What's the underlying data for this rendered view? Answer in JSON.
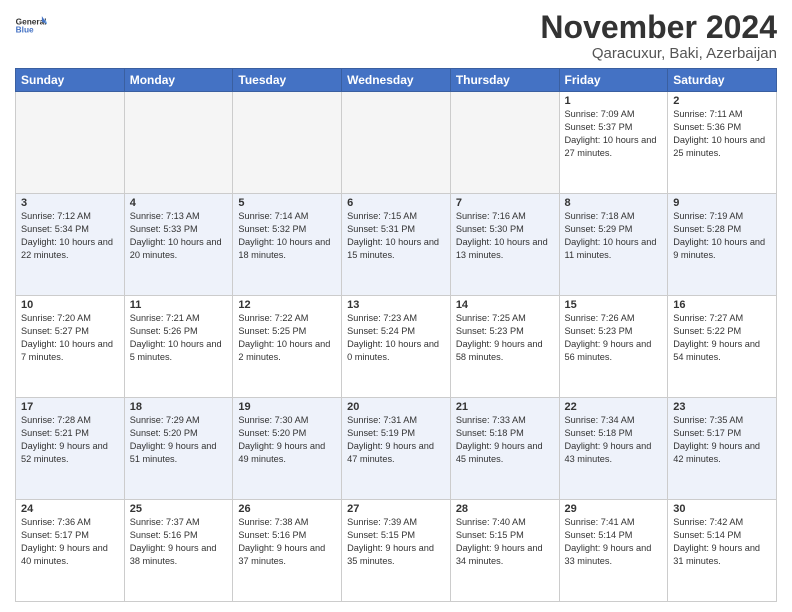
{
  "header": {
    "logo_general": "General",
    "logo_blue": "Blue",
    "month_title": "November 2024",
    "location": "Qaracuxur, Baki, Azerbaijan"
  },
  "days_of_week": [
    "Sunday",
    "Monday",
    "Tuesday",
    "Wednesday",
    "Thursday",
    "Friday",
    "Saturday"
  ],
  "weeks": [
    [
      {
        "day": "",
        "info": "",
        "empty": true
      },
      {
        "day": "",
        "info": "",
        "empty": true
      },
      {
        "day": "",
        "info": "",
        "empty": true
      },
      {
        "day": "",
        "info": "",
        "empty": true
      },
      {
        "day": "",
        "info": "",
        "empty": true
      },
      {
        "day": "1",
        "info": "Sunrise: 7:09 AM\nSunset: 5:37 PM\nDaylight: 10 hours and 27 minutes."
      },
      {
        "day": "2",
        "info": "Sunrise: 7:11 AM\nSunset: 5:36 PM\nDaylight: 10 hours and 25 minutes."
      }
    ],
    [
      {
        "day": "3",
        "info": "Sunrise: 7:12 AM\nSunset: 5:34 PM\nDaylight: 10 hours and 22 minutes."
      },
      {
        "day": "4",
        "info": "Sunrise: 7:13 AM\nSunset: 5:33 PM\nDaylight: 10 hours and 20 minutes."
      },
      {
        "day": "5",
        "info": "Sunrise: 7:14 AM\nSunset: 5:32 PM\nDaylight: 10 hours and 18 minutes."
      },
      {
        "day": "6",
        "info": "Sunrise: 7:15 AM\nSunset: 5:31 PM\nDaylight: 10 hours and 15 minutes."
      },
      {
        "day": "7",
        "info": "Sunrise: 7:16 AM\nSunset: 5:30 PM\nDaylight: 10 hours and 13 minutes."
      },
      {
        "day": "8",
        "info": "Sunrise: 7:18 AM\nSunset: 5:29 PM\nDaylight: 10 hours and 11 minutes."
      },
      {
        "day": "9",
        "info": "Sunrise: 7:19 AM\nSunset: 5:28 PM\nDaylight: 10 hours and 9 minutes."
      }
    ],
    [
      {
        "day": "10",
        "info": "Sunrise: 7:20 AM\nSunset: 5:27 PM\nDaylight: 10 hours and 7 minutes."
      },
      {
        "day": "11",
        "info": "Sunrise: 7:21 AM\nSunset: 5:26 PM\nDaylight: 10 hours and 5 minutes."
      },
      {
        "day": "12",
        "info": "Sunrise: 7:22 AM\nSunset: 5:25 PM\nDaylight: 10 hours and 2 minutes."
      },
      {
        "day": "13",
        "info": "Sunrise: 7:23 AM\nSunset: 5:24 PM\nDaylight: 10 hours and 0 minutes."
      },
      {
        "day": "14",
        "info": "Sunrise: 7:25 AM\nSunset: 5:23 PM\nDaylight: 9 hours and 58 minutes."
      },
      {
        "day": "15",
        "info": "Sunrise: 7:26 AM\nSunset: 5:23 PM\nDaylight: 9 hours and 56 minutes."
      },
      {
        "day": "16",
        "info": "Sunrise: 7:27 AM\nSunset: 5:22 PM\nDaylight: 9 hours and 54 minutes."
      }
    ],
    [
      {
        "day": "17",
        "info": "Sunrise: 7:28 AM\nSunset: 5:21 PM\nDaylight: 9 hours and 52 minutes."
      },
      {
        "day": "18",
        "info": "Sunrise: 7:29 AM\nSunset: 5:20 PM\nDaylight: 9 hours and 51 minutes."
      },
      {
        "day": "19",
        "info": "Sunrise: 7:30 AM\nSunset: 5:20 PM\nDaylight: 9 hours and 49 minutes."
      },
      {
        "day": "20",
        "info": "Sunrise: 7:31 AM\nSunset: 5:19 PM\nDaylight: 9 hours and 47 minutes."
      },
      {
        "day": "21",
        "info": "Sunrise: 7:33 AM\nSunset: 5:18 PM\nDaylight: 9 hours and 45 minutes."
      },
      {
        "day": "22",
        "info": "Sunrise: 7:34 AM\nSunset: 5:18 PM\nDaylight: 9 hours and 43 minutes."
      },
      {
        "day": "23",
        "info": "Sunrise: 7:35 AM\nSunset: 5:17 PM\nDaylight: 9 hours and 42 minutes."
      }
    ],
    [
      {
        "day": "24",
        "info": "Sunrise: 7:36 AM\nSunset: 5:17 PM\nDaylight: 9 hours and 40 minutes."
      },
      {
        "day": "25",
        "info": "Sunrise: 7:37 AM\nSunset: 5:16 PM\nDaylight: 9 hours and 38 minutes."
      },
      {
        "day": "26",
        "info": "Sunrise: 7:38 AM\nSunset: 5:16 PM\nDaylight: 9 hours and 37 minutes."
      },
      {
        "day": "27",
        "info": "Sunrise: 7:39 AM\nSunset: 5:15 PM\nDaylight: 9 hours and 35 minutes."
      },
      {
        "day": "28",
        "info": "Sunrise: 7:40 AM\nSunset: 5:15 PM\nDaylight: 9 hours and 34 minutes."
      },
      {
        "day": "29",
        "info": "Sunrise: 7:41 AM\nSunset: 5:14 PM\nDaylight: 9 hours and 33 minutes."
      },
      {
        "day": "30",
        "info": "Sunrise: 7:42 AM\nSunset: 5:14 PM\nDaylight: 9 hours and 31 minutes."
      }
    ]
  ]
}
